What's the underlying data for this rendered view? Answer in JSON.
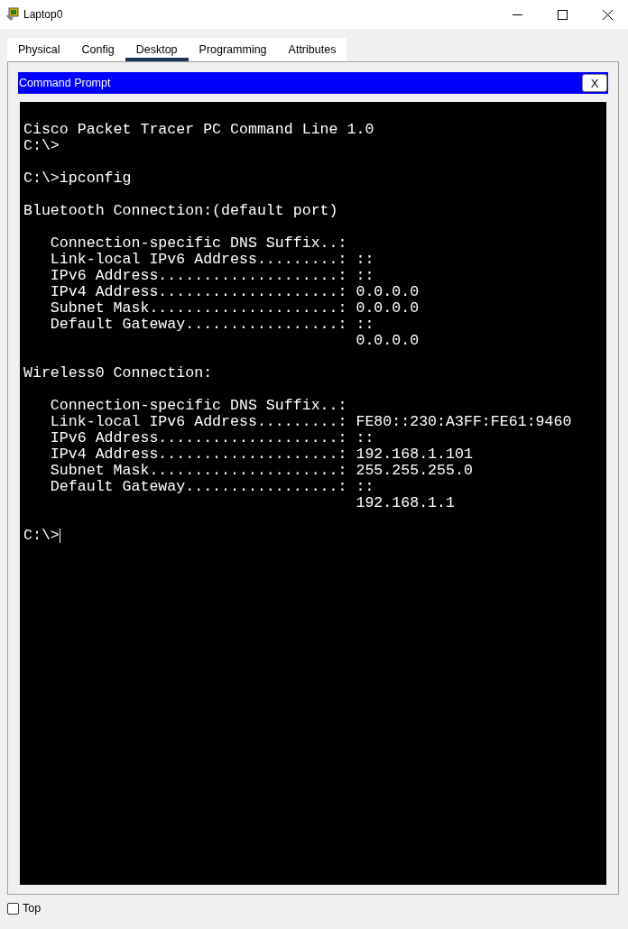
{
  "window": {
    "title": "Laptop0"
  },
  "tabs": [
    {
      "label": "Physical",
      "selected": false
    },
    {
      "label": "Config",
      "selected": false
    },
    {
      "label": "Desktop",
      "selected": true
    },
    {
      "label": "Programming",
      "selected": false
    },
    {
      "label": "Attributes",
      "selected": false
    }
  ],
  "app": {
    "title": "Command Prompt",
    "close_label": "X"
  },
  "terminal": {
    "lines": [
      {
        "kind": "text",
        "text": "Cisco Packet Tracer PC Command Line 1.0"
      },
      {
        "kind": "text",
        "text": "C:\\>"
      },
      {
        "kind": "blank"
      },
      {
        "kind": "text",
        "text": "C:\\>ipconfig"
      },
      {
        "kind": "blank"
      },
      {
        "kind": "text",
        "text": "Bluetooth Connection:(default port)"
      },
      {
        "kind": "blank"
      },
      {
        "kind": "text",
        "text": "   Connection-specific DNS Suffix..:"
      },
      {
        "kind": "text",
        "text": "   Link-local IPv6 Address.........: ::"
      },
      {
        "kind": "text",
        "text": "   IPv6 Address....................: ::"
      },
      {
        "kind": "text",
        "text": "   IPv4 Address....................: 0.0.0.0"
      },
      {
        "kind": "text",
        "text": "   Subnet Mask.....................: 0.0.0.0"
      },
      {
        "kind": "text",
        "text": "   Default Gateway.................: ::"
      },
      {
        "kind": "text",
        "text": "                                     0.0.0.0"
      },
      {
        "kind": "blank"
      },
      {
        "kind": "text",
        "text": "Wireless0 Connection:"
      },
      {
        "kind": "blank"
      },
      {
        "kind": "text",
        "text": "   Connection-specific DNS Suffix..:"
      },
      {
        "kind": "text",
        "text": "   Link-local IPv6 Address.........: FE80::230:A3FF:FE61:9460"
      },
      {
        "kind": "text",
        "text": "   IPv6 Address....................: ::"
      },
      {
        "kind": "text",
        "text": "   IPv4 Address....................: 192.168.1.101"
      },
      {
        "kind": "text",
        "text": "   Subnet Mask.....................: 255.255.255.0"
      },
      {
        "kind": "text",
        "text": "   Default Gateway.................: ::"
      },
      {
        "kind": "text",
        "text": "                                     192.168.1.1"
      },
      {
        "kind": "blank"
      },
      {
        "kind": "prompt",
        "text": "C:\\>"
      }
    ]
  },
  "top_checkbox": {
    "label": "Top",
    "checked": false
  }
}
